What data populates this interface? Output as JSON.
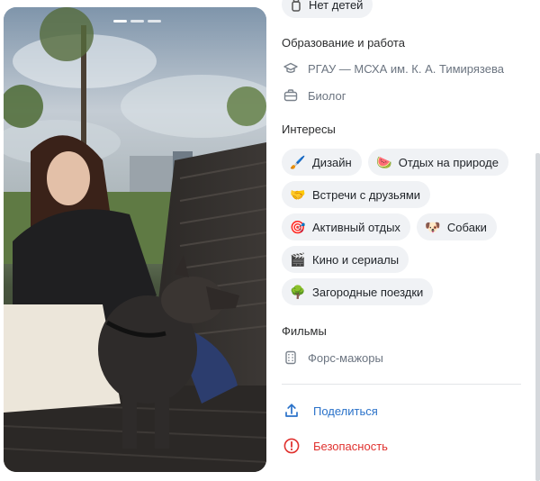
{
  "top_chip": {
    "icon": "baby-bottle-icon",
    "label": "Нет детей"
  },
  "education": {
    "title": "Образование и работа",
    "university": "РГАУ — МСХА им. К. А. Тимирязева",
    "profession": "Биолог"
  },
  "interests": {
    "title": "Интересы",
    "items": [
      {
        "emoji": "🖌️",
        "label": "Дизайн"
      },
      {
        "emoji": "🍉",
        "label": "Отдых на природе"
      },
      {
        "emoji": "🤝",
        "label": "Встречи с друзьями"
      },
      {
        "emoji": "🎯",
        "label": "Активный отдых"
      },
      {
        "emoji": "🐶",
        "label": "Собаки"
      },
      {
        "emoji": "🎬",
        "label": "Кино и сериалы"
      },
      {
        "emoji": "🌳",
        "label": "Загородные поездки"
      }
    ]
  },
  "films": {
    "title": "Фильмы",
    "item": "Форс-мажоры"
  },
  "actions": {
    "share_label": "Поделиться",
    "security_label": "Безопасность"
  },
  "colors": {
    "accent": "#2a72c9",
    "danger": "#e0322f",
    "chip_bg": "#f0f2f5",
    "muted": "#6b7480"
  }
}
